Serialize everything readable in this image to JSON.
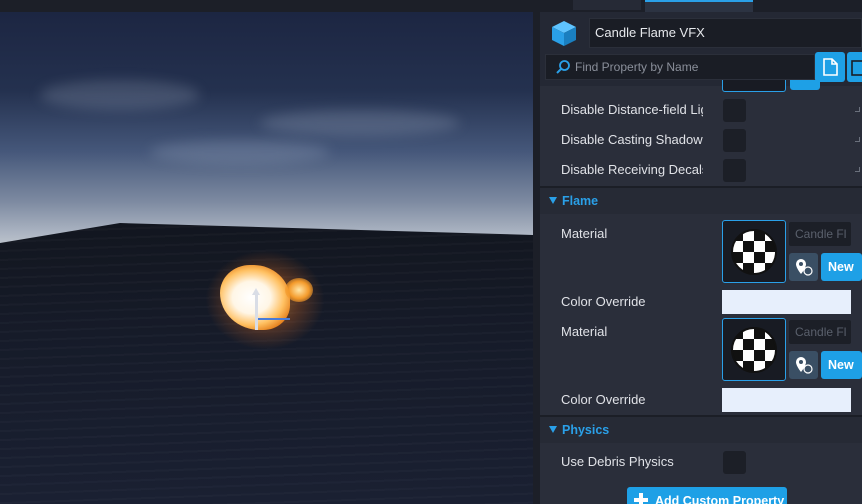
{
  "details_panel": {
    "actor_name": "Candle Flame VFX",
    "search_placeholder": "Find Property by Name",
    "rows": [
      {
        "label": "Disable Distance-field Lig",
        "checked": false
      },
      {
        "label": "Disable Casting Shadows",
        "checked": false
      },
      {
        "label": "Disable Receiving Decals",
        "checked": false
      }
    ],
    "flame_section": {
      "title": "Flame",
      "material_label": "Material",
      "color_override_label": "Color Override",
      "materials": [
        {
          "asset_name": "Candle Fl",
          "new_label": "New",
          "color_override": "#e7effc"
        },
        {
          "asset_name": "Candle Fl",
          "new_label": "New",
          "color_override": "#e7effc"
        }
      ]
    },
    "physics_section": {
      "title": "Physics",
      "rows": [
        {
          "label": "Use Debris Physics",
          "checked": false
        }
      ]
    },
    "add_custom_property_label": "Add Custom Property"
  },
  "colors": {
    "accent": "#2aa0e8",
    "button": "#1ea0e6",
    "panel_bg": "#2a2e3a",
    "color_override": "#e7effc"
  },
  "icons": {
    "actor": "cube-icon",
    "search": "search-icon",
    "document": "document-icon",
    "material_browse": "map-pin-icon",
    "add": "plus-icon",
    "material_thumb": "checker-sphere-icon"
  }
}
